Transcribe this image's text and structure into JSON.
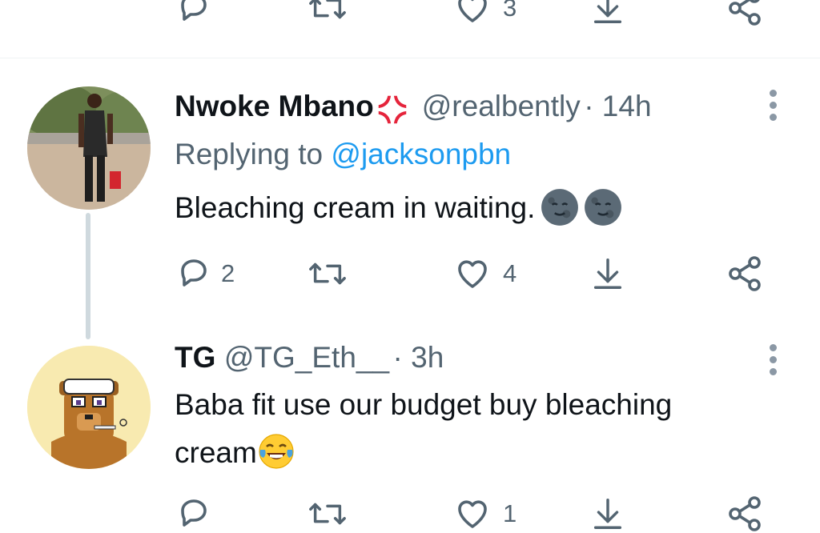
{
  "colors": {
    "text": "#0f1419",
    "secondary": "#536471",
    "link": "#1d9bf0",
    "thread_line": "#cfd9de",
    "divider": "#eff3f4"
  },
  "top_actions": {
    "like_count": "3"
  },
  "tweets": [
    {
      "name": "Nwoke Mbano",
      "name_emoji": "anger-symbol-emoji",
      "handle": "@realbently",
      "time": "· 14h",
      "replying_prefix": "Replying to",
      "replying_to": "@jacksonpbn",
      "text": "Bleaching cream in waiting.",
      "text_emojis": [
        "new-moon-face-emoji",
        "new-moon-face-emoji"
      ],
      "reply_count": "2",
      "retweet_count": "",
      "like_count": "4"
    },
    {
      "name": "TG",
      "handle": "@TG_Eth__",
      "time": "· 3h",
      "text_line1": "Baba fit use our budget buy bleaching",
      "text_line2": "cream",
      "text_emojis": [
        "tears-of-joy-emoji"
      ],
      "like_count": "1"
    }
  ]
}
